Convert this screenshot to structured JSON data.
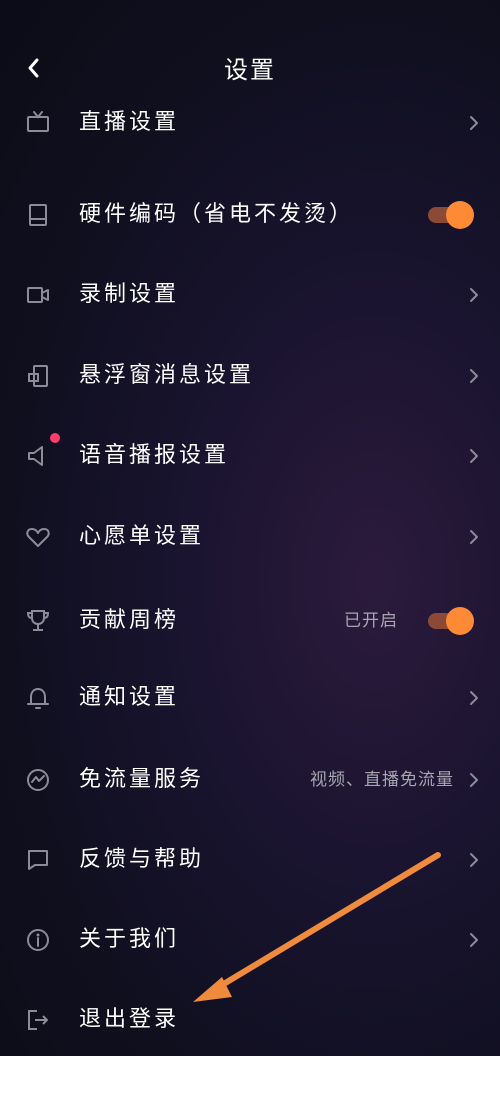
{
  "header": {
    "title": "设置",
    "back_icon": "chevron-left-icon"
  },
  "settings": [
    {
      "label": "直播设置",
      "icon": "tv-icon",
      "control": "chevron"
    },
    {
      "label": "硬件编码（省电不发烫）",
      "icon": "tablet-icon",
      "control": "toggle",
      "toggle_on": true
    },
    {
      "label": "录制设置",
      "icon": "video-camera-icon",
      "control": "chevron"
    },
    {
      "label": "悬浮窗消息设置",
      "icon": "floating-window-icon",
      "control": "chevron"
    },
    {
      "label": "语音播报设置",
      "icon": "speaker-icon",
      "control": "chevron",
      "badge": "red-dot"
    },
    {
      "label": "心愿单设置",
      "icon": "heart-icon",
      "control": "chevron"
    },
    {
      "label": "贡献周榜",
      "icon": "trophy-icon",
      "control": "toggle",
      "value": "已开启",
      "toggle_on": true
    },
    {
      "label": "通知设置",
      "icon": "bell-icon",
      "control": "chevron"
    },
    {
      "label": "免流量服务",
      "icon": "data-saver-icon",
      "control": "chevron",
      "value": "视频、直播免流量"
    },
    {
      "label": "反馈与帮助",
      "icon": "chat-icon",
      "control": "chevron"
    },
    {
      "label": "关于我们",
      "icon": "info-icon",
      "control": "chevron"
    },
    {
      "label": "退出登录",
      "icon": "logout-icon",
      "control": "none"
    }
  ],
  "colors": {
    "accent": "#ff8a36",
    "toggle_track": "#8a4a35",
    "badge": "#ff3d6a",
    "annotation_arrow": "#f08a3c"
  }
}
